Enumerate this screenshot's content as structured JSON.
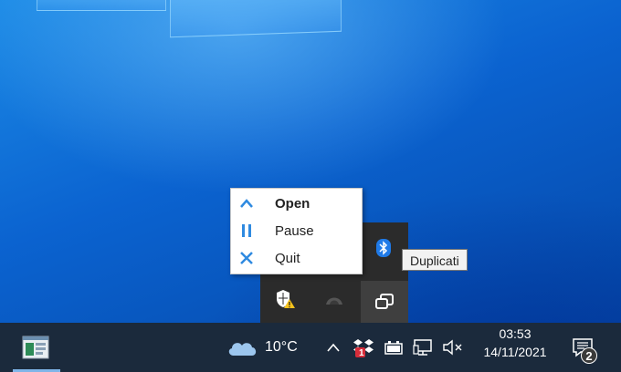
{
  "context_menu": {
    "items": [
      {
        "label": "Open",
        "icon": "chevron-up-icon"
      },
      {
        "label": "Pause",
        "icon": "pause-icon"
      },
      {
        "label": "Quit",
        "icon": "close-icon"
      }
    ]
  },
  "tooltip": {
    "text": "Duplicati"
  },
  "tray_overflow": {
    "icons": [
      "bluetooth-icon",
      "security-warning-icon",
      "duplicati-icon",
      "duplicati-tray-icon"
    ]
  },
  "taskbar": {
    "weather": {
      "temperature": "10°C",
      "icon": "cloud-icon"
    },
    "clock": {
      "time": "03:53",
      "date": "14/11/2021"
    },
    "notifications": {
      "count": "2"
    },
    "dropbox_badge": "1",
    "tray_icons": [
      "show-hidden-icons-chevron",
      "dropbox-icon",
      "battery-icon",
      "network-icon",
      "volume-muted-icon"
    ]
  },
  "colors": {
    "accent": "#2f8ae0",
    "taskbar": "#1b2a3c",
    "tray_flyout": "#2b2b2b"
  }
}
